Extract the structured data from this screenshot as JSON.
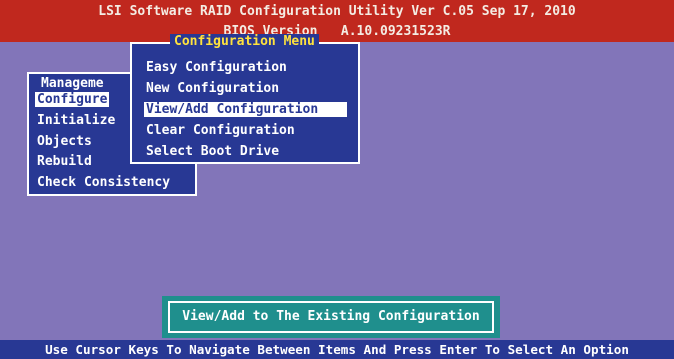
{
  "header": {
    "title": "LSI Software RAID Configuration Utility Ver C.05 Sep 17, 2010",
    "bios_version": "BIOS Version   A.10.09231523R"
  },
  "management_menu": {
    "title": "Manageme",
    "items": [
      "Configure",
      "Initialize",
      "Objects",
      "Rebuild",
      "Check Consistency"
    ],
    "selected_index": 0
  },
  "configuration_menu": {
    "title": "Configuration Menu",
    "items": [
      "Easy Configuration",
      "New Configuration",
      "View/Add Configuration",
      "Clear Configuration",
      "Select Boot Drive"
    ],
    "selected_index": 2
  },
  "status": {
    "message": "View/Add to The Existing Configuration"
  },
  "help_bar": {
    "text": "Use Cursor Keys To Navigate Between Items And Press Enter To Select An Option"
  },
  "colors": {
    "background": "#8275b9",
    "header": "#c0281e",
    "menu": "#283894",
    "menu_title": "#ffe23d",
    "status_box": "#1f8f8d"
  }
}
